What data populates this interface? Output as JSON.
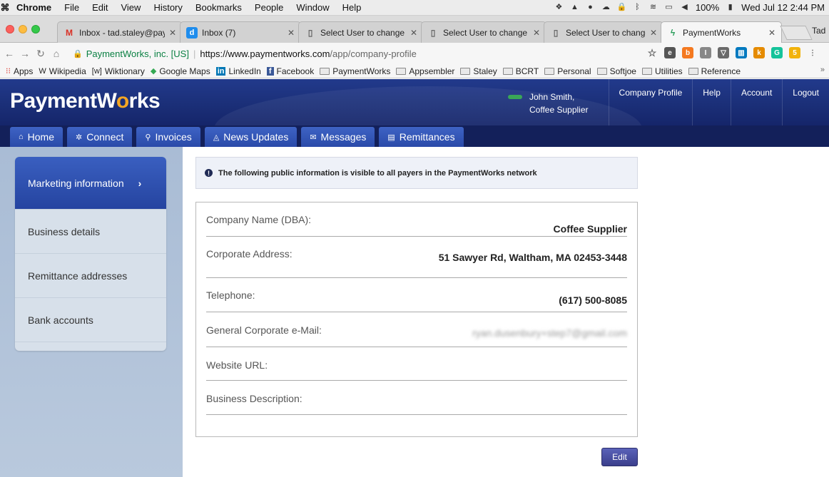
{
  "menubar": {
    "app": "Chrome",
    "items": [
      "File",
      "Edit",
      "View",
      "History",
      "Bookmarks",
      "People",
      "Window",
      "Help"
    ],
    "battery": "100%",
    "clock": "Wed Jul 12 2:44 PM"
  },
  "tabs": [
    {
      "icon": "gmail-icon",
      "title": "Inbox - tad.staley@pay",
      "active": false
    },
    {
      "icon": "intercom-icon",
      "title": "Inbox (7)",
      "active": false
    },
    {
      "icon": "doc-icon",
      "title": "Select User to change",
      "active": false
    },
    {
      "icon": "doc-icon",
      "title": "Select User to change",
      "active": false
    },
    {
      "icon": "doc-icon",
      "title": "Select User to change",
      "active": false
    },
    {
      "icon": "paymentworks-icon",
      "title": "PaymentWorks",
      "active": true
    }
  ],
  "profile_name": "Tad",
  "address": {
    "secure_label": "PaymentWorks, inc. [US]",
    "host": "https://www.paymentworks.com",
    "path": "/app/company-profile"
  },
  "bookmarks": [
    {
      "icon": "apps-icon",
      "label": "Apps"
    },
    {
      "icon": "wikipedia-icon",
      "label": "Wikipedia"
    },
    {
      "icon": "wiktionary-icon",
      "label": "Wiktionary"
    },
    {
      "icon": "maps-icon",
      "label": "Google Maps"
    },
    {
      "icon": "linkedin-icon",
      "label": "LinkedIn"
    },
    {
      "icon": "facebook-icon",
      "label": "Facebook"
    },
    {
      "icon": "folder-icon",
      "label": "PaymentWorks"
    },
    {
      "icon": "folder-icon",
      "label": "Appsembler"
    },
    {
      "icon": "folder-icon",
      "label": "Staley"
    },
    {
      "icon": "folder-icon",
      "label": "BCRT"
    },
    {
      "icon": "folder-icon",
      "label": "Personal"
    },
    {
      "icon": "folder-icon",
      "label": "Softjoe"
    },
    {
      "icon": "folder-icon",
      "label": "Utilities"
    },
    {
      "icon": "folder-icon",
      "label": "Reference"
    }
  ],
  "header": {
    "logo_pre": "PaymentW",
    "logo_o": "o",
    "logo_post": "rks",
    "user_name": "John Smith,",
    "user_company": "Coffee Supplier",
    "links": [
      "Company Profile",
      "Help",
      "Account",
      "Logout"
    ]
  },
  "nav": [
    {
      "icon": "home-icon",
      "label": "Home"
    },
    {
      "icon": "gear-icon",
      "label": "Connect"
    },
    {
      "icon": "person-icon",
      "label": "Invoices"
    },
    {
      "icon": "megaphone-icon",
      "label": "News Updates"
    },
    {
      "icon": "envelope-icon",
      "label": "Messages"
    },
    {
      "icon": "bank-icon",
      "label": "Remittances"
    }
  ],
  "sidebar": {
    "items": [
      {
        "label": "Marketing information",
        "active": true
      },
      {
        "label": "Business details",
        "active": false
      },
      {
        "label": "Remittance addresses",
        "active": false
      },
      {
        "label": "Bank accounts",
        "active": false
      }
    ]
  },
  "notice": "The following public information is visible to all payers in the PaymentWorks network",
  "fields": [
    {
      "label": "Company Name (DBA):",
      "value": "Coffee Supplier"
    },
    {
      "label": "Corporate Address:",
      "value": "51 Sawyer Rd, Waltham, MA 02453-3448"
    },
    {
      "label": "Telephone:",
      "value": "(617) 500-8085"
    },
    {
      "label": "General Corporate e-Mail:",
      "value": "ryan.dusenbury+step7@gmail.com"
    },
    {
      "label": "Website URL:",
      "value": ""
    },
    {
      "label": "Business Description:",
      "value": ""
    }
  ],
  "edit_label": "Edit"
}
